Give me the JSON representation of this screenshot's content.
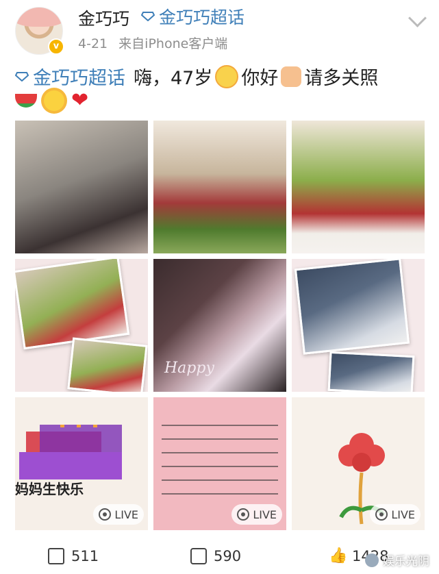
{
  "header": {
    "username": "金巧巧",
    "topic": "金巧巧超话",
    "time": "4-21",
    "source": "来自iPhone客户端"
  },
  "post": {
    "topic": "金巧巧超话",
    "text_part1": "嗨，47岁",
    "text_part2": "你好",
    "text_part3": "请多关照",
    "emojis": [
      "watermelon-emoji",
      "sun-emoji",
      "heart-emoji"
    ]
  },
  "photos": [
    {
      "name": "photo-1"
    },
    {
      "name": "photo-2"
    },
    {
      "name": "photo-3"
    },
    {
      "name": "photo-4"
    },
    {
      "name": "photo-5",
      "caption": "Happy"
    },
    {
      "name": "photo-6"
    },
    {
      "name": "photo-7",
      "text": "妈妈生快乐",
      "live": "LIVE"
    },
    {
      "name": "photo-8",
      "live": "LIVE"
    },
    {
      "name": "photo-9",
      "live": "LIVE"
    }
  ],
  "footer": {
    "share_count": "511",
    "comment_count": "590",
    "like_count": "1428"
  },
  "watermark": "娱乐光阴",
  "colors": {
    "link": "#3f7fb8",
    "meta": "#8d8d8d",
    "verified": "#f7b500"
  }
}
